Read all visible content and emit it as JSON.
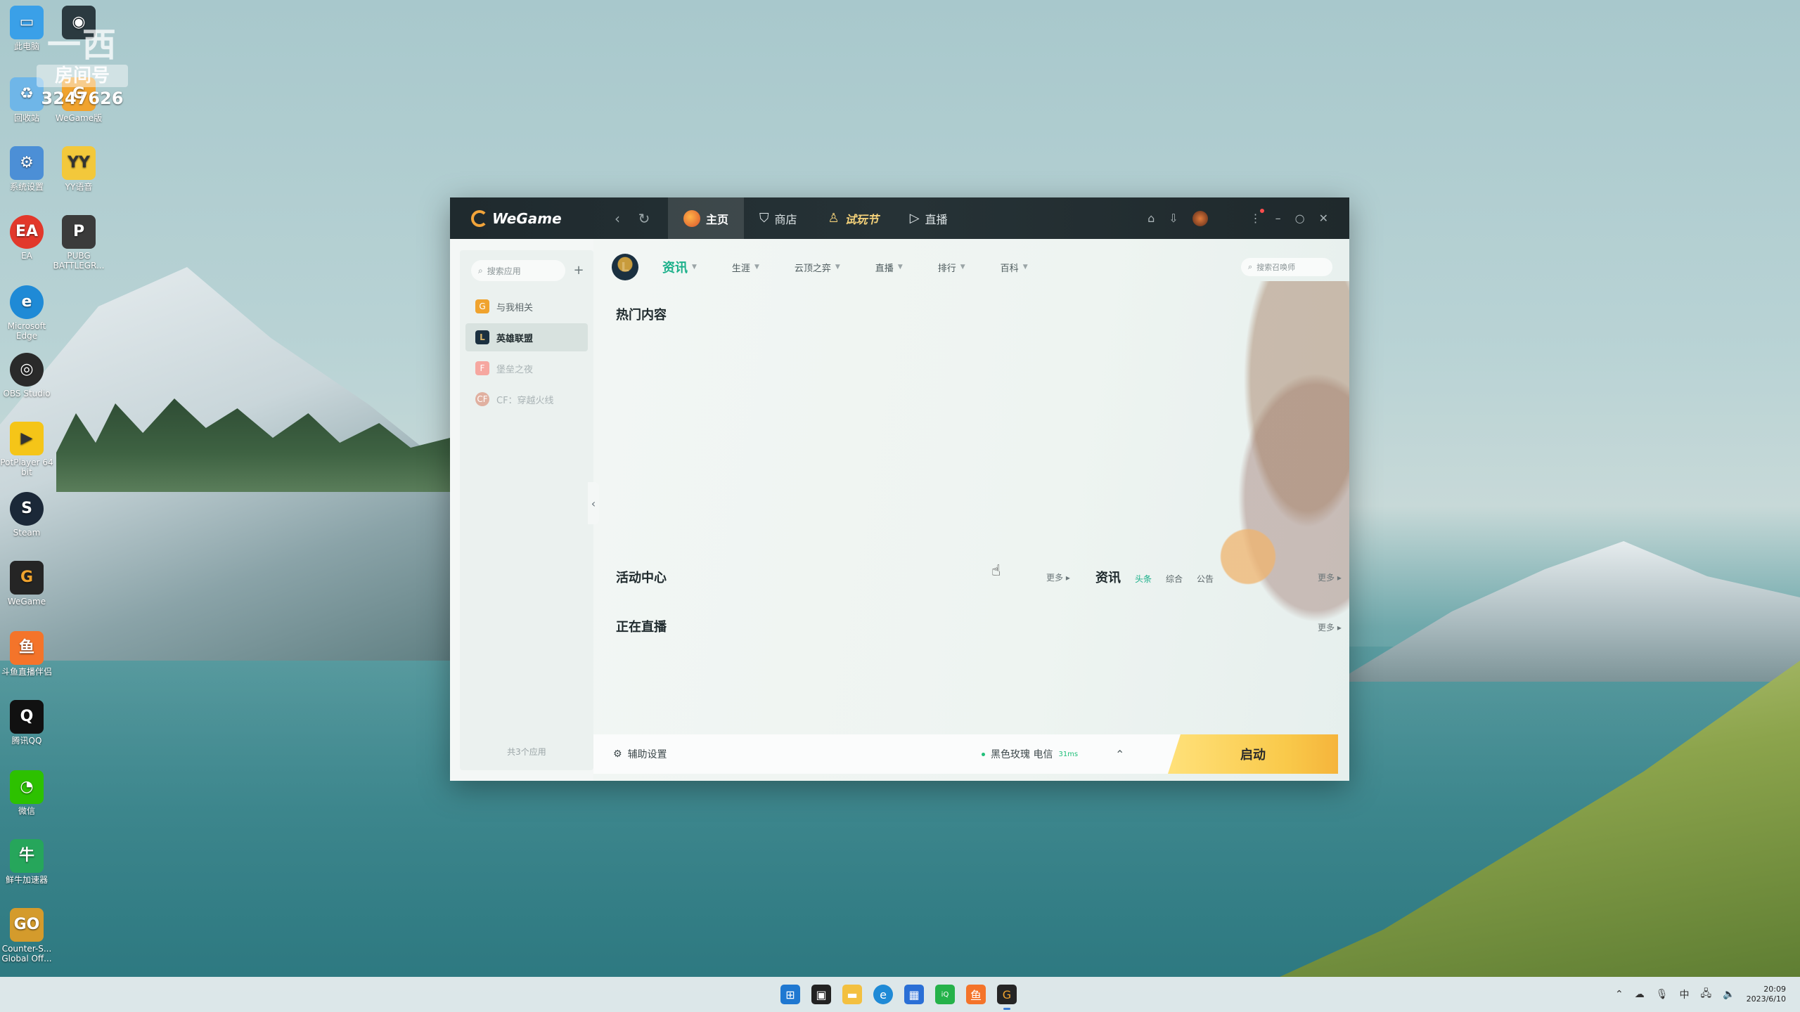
{
  "watermark": {
    "line1": "一西",
    "line2": "房间号",
    "line3": "3247626"
  },
  "desktop": {
    "icons": [
      {
        "label": "此电脑",
        "icon": "computer-icon",
        "color": "#3aa0e8"
      },
      {
        "label": "",
        "icon": "app-dark-icon",
        "color": "#2b3a40"
      },
      {
        "label": "回收站",
        "icon": "recycle-bin-icon",
        "color": "#6fb6e8"
      },
      {
        "label": "WeGame版",
        "icon": "wegame-shortcut-icon",
        "color": "#f0a32e"
      },
      {
        "label": "系统设置",
        "icon": "settings-icon",
        "color": "#4c8fd6"
      },
      {
        "label": "YY语音",
        "icon": "yy-icon",
        "color": "#f3c83b"
      },
      {
        "label": "EA",
        "icon": "ea-icon",
        "color": "#e2382b"
      },
      {
        "label": "PUBG BATTLEGR...",
        "icon": "pubg-icon",
        "color": "#3b3b3b"
      },
      {
        "label": "Microsoft Edge",
        "icon": "edge-icon",
        "color": "#1f8ad6"
      },
      {
        "label": "OBS Studio",
        "icon": "obs-icon",
        "color": "#2a2a2a"
      },
      {
        "label": "PotPlayer 64 bit",
        "icon": "potplayer-icon",
        "color": "#f5c518"
      },
      {
        "label": "Steam",
        "icon": "steam-icon",
        "color": "#1b2838"
      },
      {
        "label": "WeGame",
        "icon": "wegame-icon",
        "color": "#252525"
      },
      {
        "label": "斗鱼直播伴侣",
        "icon": "douyu-icon",
        "color": "#f4742a"
      },
      {
        "label": "腾讯QQ",
        "icon": "qq-icon",
        "color": "#111"
      },
      {
        "label": "微信",
        "icon": "wechat-icon",
        "color": "#2dc100"
      },
      {
        "label": "鲜牛加速器",
        "icon": "accelerator-icon",
        "color": "#26a65b"
      },
      {
        "label": "Counter-S... Global Off...",
        "icon": "csgo-icon",
        "color": "#d49b2c"
      }
    ]
  },
  "titlebar": {
    "brand": "WeGame",
    "tabs": [
      {
        "label": "主页",
        "icon": "home-icon"
      },
      {
        "label": "商店",
        "icon": "store-bag-icon"
      },
      {
        "label": "试玩节",
        "icon": "event-icon"
      },
      {
        "label": "直播",
        "icon": "live-play-icon"
      }
    ]
  },
  "sidebar": {
    "search_placeholder": "搜索应用",
    "items": [
      {
        "label": "与我相关",
        "icon": "wegame-mini-icon",
        "color": "#f0a32e"
      },
      {
        "label": "英雄联盟",
        "icon": "lol-icon",
        "color": "#1b3040"
      },
      {
        "label": "堡垒之夜",
        "icon": "fortnite-icon",
        "color": "#f6a7a0"
      },
      {
        "label": "CF：穿越火线",
        "icon": "cf-icon",
        "color": "#e0b0a0"
      }
    ],
    "footer": "共3个应用"
  },
  "main": {
    "subtabs": [
      {
        "label": "资讯"
      },
      {
        "label": "生涯"
      },
      {
        "label": "云顶之弈"
      },
      {
        "label": "直播"
      },
      {
        "label": "排行"
      },
      {
        "label": "百科"
      }
    ],
    "search_placeholder": "搜索召唤师",
    "hot_title": "热门内容",
    "activity_title": "活动中心",
    "activity_more": "更多 ▸",
    "news_title": "资讯",
    "news_tabs": [
      "头条",
      "综合",
      "公告"
    ],
    "news_more": "更多 ▸",
    "live_title": "正在直播",
    "live_more": "更多 ▸"
  },
  "bottombar": {
    "assist_label": "辅助设置",
    "server": "黑色玫瑰 电信",
    "ping": "31ms",
    "launch_label": "启动"
  },
  "taskbar": {
    "apps": [
      {
        "name": "windows-start-icon",
        "color": "#1f78d1"
      },
      {
        "name": "taskview-icon",
        "color": "#222"
      },
      {
        "name": "file-explorer-icon",
        "color": "#f3c040"
      },
      {
        "name": "edge-icon",
        "color": "#1f8ad6"
      },
      {
        "name": "store-icon",
        "color": "#2a6fd6"
      },
      {
        "name": "iqiyi-icon",
        "color": "#25b24a"
      },
      {
        "name": "douyu-icon",
        "color": "#f4742a"
      },
      {
        "name": "wegame-icon",
        "color": "#252525"
      }
    ],
    "ime": "中",
    "time": "20:09",
    "date": "2023/6/10"
  },
  "colors": {
    "accent": "#1bb08a",
    "launch": "#f9c94a"
  }
}
